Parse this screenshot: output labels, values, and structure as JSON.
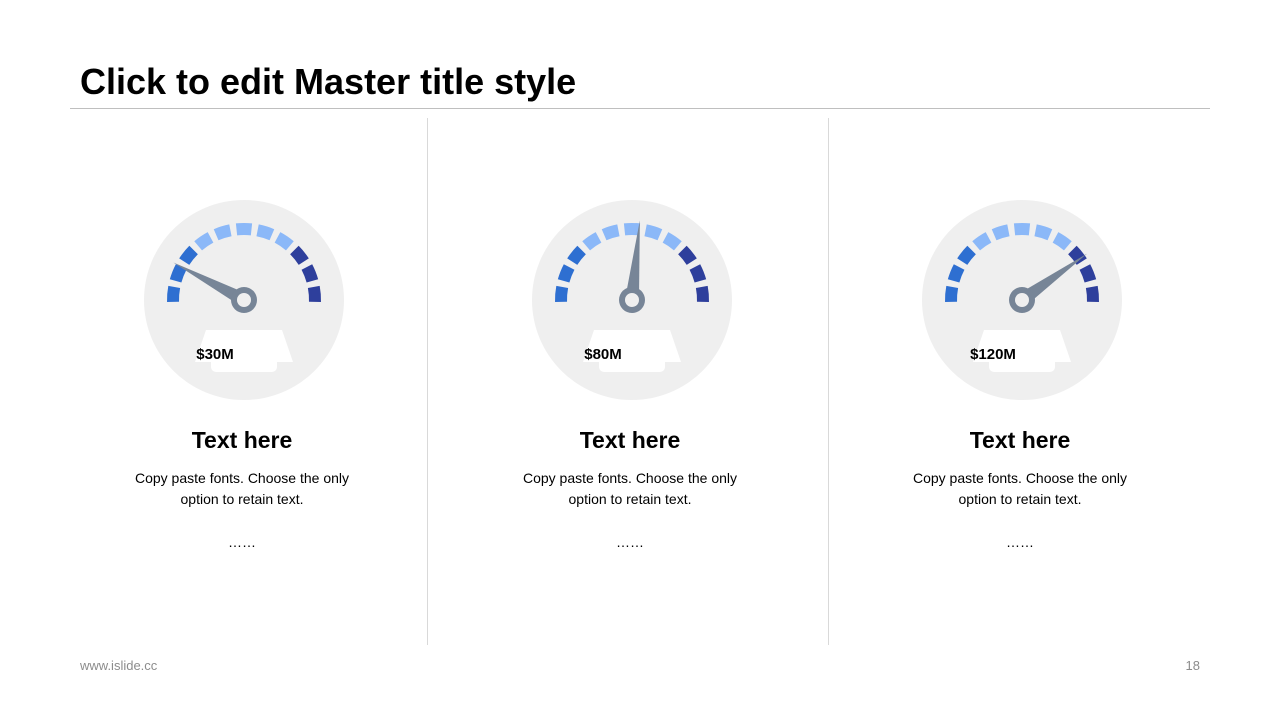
{
  "slide": {
    "title": "Click to edit Master title style",
    "footer_url": "www.islide.cc",
    "page_number": "18"
  },
  "colors": {
    "gauge_face": "#efefef",
    "segment_light": "#8bb8f8",
    "segment_mid": "#2e6fd1",
    "segment_dark": "#2e3f9c",
    "needle": "#778597",
    "label_box": "#ffffff",
    "divider": "#d9d9d9"
  },
  "panels": [
    {
      "value_label": "$30M",
      "needle_fraction": 0.17,
      "heading": "Text here",
      "body": "Copy paste fonts. Choose the only option to retain text.",
      "dots": "……"
    },
    {
      "value_label": "$80M",
      "needle_fraction": 0.53,
      "heading": "Text here",
      "body": "Copy paste fonts. Choose the only option to retain text.",
      "dots": "……"
    },
    {
      "value_label": "$120M",
      "needle_fraction": 0.79,
      "heading": "Text here",
      "body": "Copy paste fonts. Choose the only option to retain text.",
      "dots": "……"
    }
  ]
}
